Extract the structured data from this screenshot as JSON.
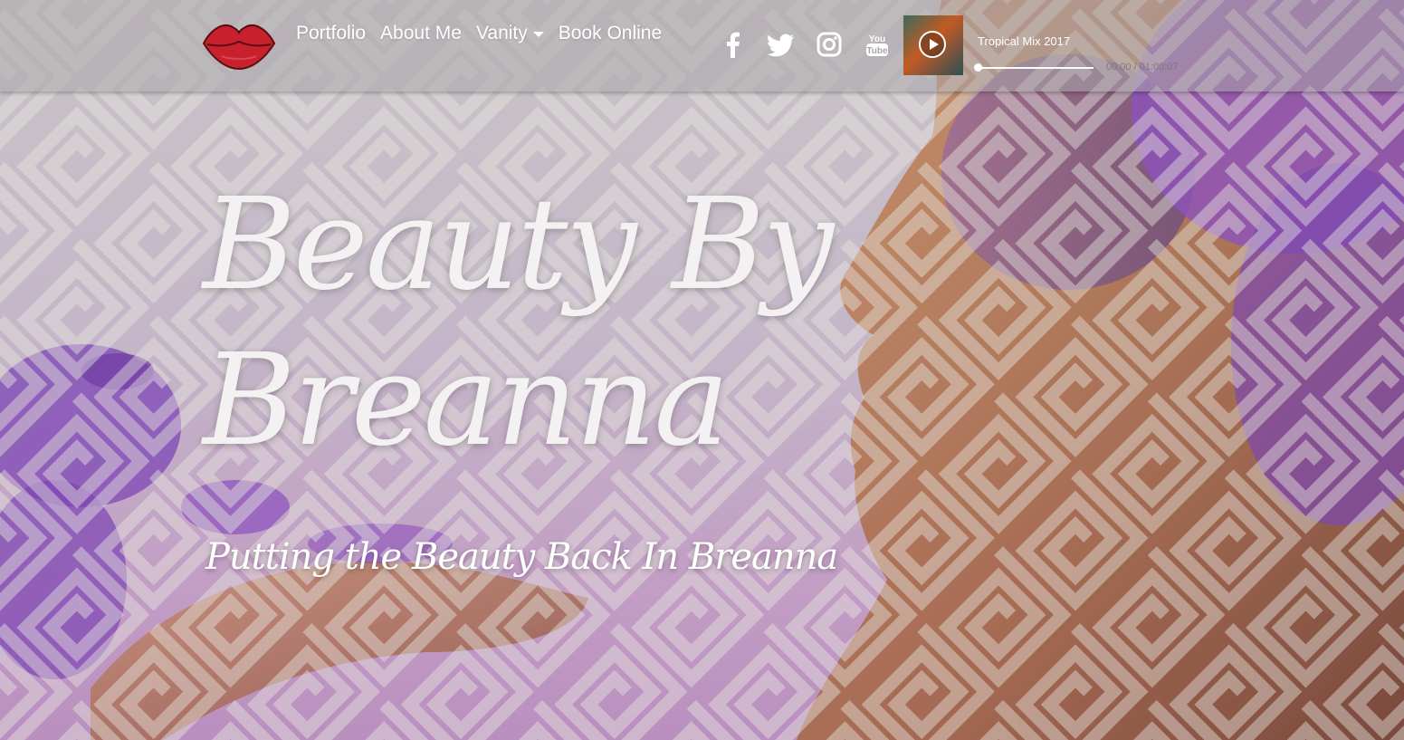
{
  "nav": {
    "logo_icon": "lips-icon",
    "menu": [
      {
        "label": "Portfolio"
      },
      {
        "label": "About Me"
      },
      {
        "label": "Vanity",
        "has_dropdown": true
      },
      {
        "label": "Book Online"
      }
    ],
    "social": [
      "facebook-icon",
      "twitter-icon",
      "instagram-icon",
      "youtube-icon"
    ]
  },
  "player": {
    "track_title": "Tropical Mix 2017",
    "time": "00:00 / 01:00:07",
    "progress": 0,
    "button_icon": "play-icon"
  },
  "hero": {
    "title": "Beauty By Breanna",
    "subtitle": "Putting the Beauty Back In Breanna"
  },
  "colors": {
    "accent_purple": "#8e4fb6",
    "lips_red": "#c8202c",
    "text": "#ffffff"
  }
}
